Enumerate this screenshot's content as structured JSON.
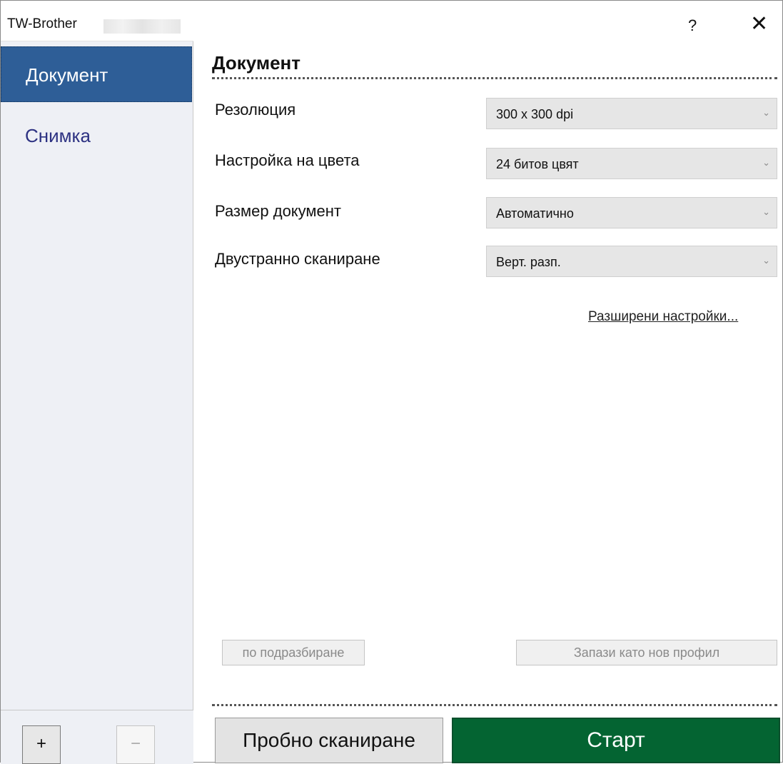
{
  "window": {
    "app_title": "TW-Brother",
    "help_label": "?",
    "close_label": "✕"
  },
  "sidebar": {
    "items": [
      {
        "label": "Документ",
        "selected": true
      },
      {
        "label": "Снимка",
        "selected": false
      }
    ],
    "add_label": "+",
    "remove_label": "−"
  },
  "main": {
    "section_title": "Документ",
    "fields": [
      {
        "label": "Резолюция",
        "value": "300 x 300 dpi"
      },
      {
        "label": "Настройка на цвета",
        "value": "24 битов цвят"
      },
      {
        "label": "Размер документ",
        "value": "Автоматично"
      },
      {
        "label": "Двустранно сканиране",
        "value": "Верт. разп."
      }
    ],
    "advanced_link": "Разширени настройки...",
    "default_button": "по подразбиране",
    "save_profile_button": "Запази като нов профил",
    "preview_button": "Пробно сканиране",
    "start_button": "Старт"
  },
  "colors": {
    "selected_nav": "#2e5e97",
    "start_button": "#046432",
    "nav_text": "#2d3282"
  }
}
